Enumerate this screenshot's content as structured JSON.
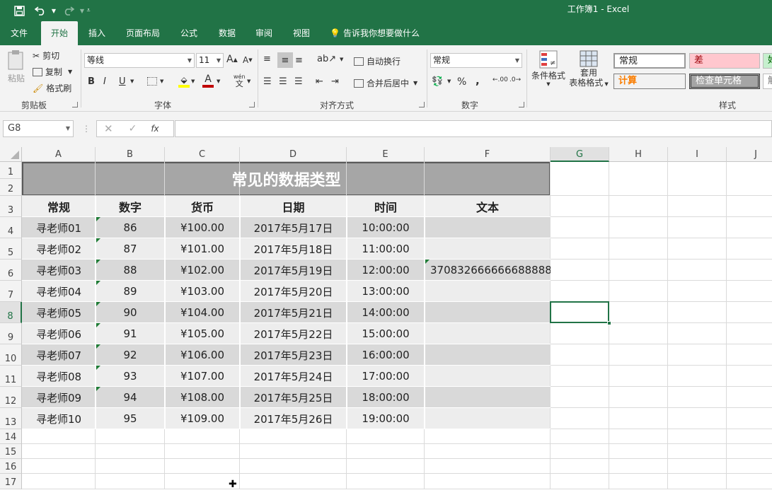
{
  "app": {
    "title": "工作簿1  -  Excel"
  },
  "quick_access": {
    "save_icon": "save-icon",
    "undo_icon": "undo-icon",
    "redo_icon": "redo-icon",
    "customize_icon": "customize-icon"
  },
  "tabs": [
    "文件",
    "开始",
    "插入",
    "页面布局",
    "公式",
    "数据",
    "审阅",
    "视图"
  ],
  "active_tab": "开始",
  "tell_me": "告诉我你想要做什么",
  "ribbon": {
    "clipboard": {
      "label": "剪贴板",
      "paste": "粘贴",
      "cut": "剪切",
      "copy": "复制",
      "format_painter": "格式刷"
    },
    "font": {
      "label": "字体",
      "name": "等线",
      "size": "11",
      "wen": "wén",
      "wen_char": "文"
    },
    "alignment": {
      "label": "对齐方式",
      "wrap": "自动换行",
      "merge": "合并后居中"
    },
    "number": {
      "label": "数字",
      "format": "常规",
      "percent": "%",
      "comma": ",",
      "inc_decimal": ".00",
      "dec_decimal": ".0"
    },
    "styles": {
      "label": "样式",
      "conditional": "条件格式",
      "table_format_1": "套用",
      "table_format_2": "表格格式",
      "cell_styles": [
        {
          "name": "常规",
          "bg": "#ffffff",
          "color": "#222222"
        },
        {
          "name": "差",
          "bg": "#ffc7ce",
          "color": "#9c0006"
        },
        {
          "name": "好",
          "bg": "#c6efce",
          "color": "#006100"
        },
        {
          "name": "计算",
          "bg": "#f2f2f2",
          "color": "#fa7d00"
        },
        {
          "name": "检查单元格",
          "bg": "#a5a5a5",
          "color": "#ffffff"
        },
        {
          "name": "解",
          "bg": "#ffffff",
          "color": "#7f7f7f"
        }
      ]
    }
  },
  "formula_bar": {
    "name_box": "G8",
    "fx": "fx",
    "value": ""
  },
  "columns": [
    "A",
    "B",
    "C",
    "D",
    "E",
    "F",
    "G",
    "H",
    "I",
    "J"
  ],
  "rows": [
    "1",
    "2",
    "3",
    "4",
    "5",
    "6",
    "7",
    "8",
    "9",
    "10",
    "11",
    "12",
    "13",
    "14",
    "15",
    "16",
    "17"
  ],
  "selected_cell": {
    "column": "G",
    "row": "8"
  },
  "sheet": {
    "title": "常见的数据类型",
    "headers": [
      "常规",
      "数字",
      "货币",
      "日期",
      "时间",
      "文本"
    ],
    "records": [
      [
        "寻老师01",
        "86",
        "¥100.00",
        "2017年5月17日",
        "10:00:00",
        ""
      ],
      [
        "寻老师02",
        "87",
        "¥101.00",
        "2017年5月18日",
        "11:00:00",
        ""
      ],
      [
        "寻老师03",
        "88",
        "¥102.00",
        "2017年5月19日",
        "12:00:00",
        "370832666666688888"
      ],
      [
        "寻老师04",
        "89",
        "¥103.00",
        "2017年5月20日",
        "13:00:00",
        ""
      ],
      [
        "寻老师05",
        "90",
        "¥104.00",
        "2017年5月21日",
        "14:00:00",
        ""
      ],
      [
        "寻老师06",
        "91",
        "¥105.00",
        "2017年5月22日",
        "15:00:00",
        ""
      ],
      [
        "寻老师07",
        "92",
        "¥106.00",
        "2017年5月23日",
        "16:00:00",
        ""
      ],
      [
        "寻老师08",
        "93",
        "¥107.00",
        "2017年5月24日",
        "17:00:00",
        ""
      ],
      [
        "寻老师09",
        "94",
        "¥108.00",
        "2017年5月25日",
        "18:00:00",
        ""
      ],
      [
        "寻老师10",
        "95",
        "¥109.00",
        "2017年5月26日",
        "19:00:00",
        ""
      ]
    ],
    "band_colors": [
      "#d9d9d9",
      "#ededed"
    ],
    "title_bg": "#a6a6a6",
    "header_bg": "#efefef"
  }
}
